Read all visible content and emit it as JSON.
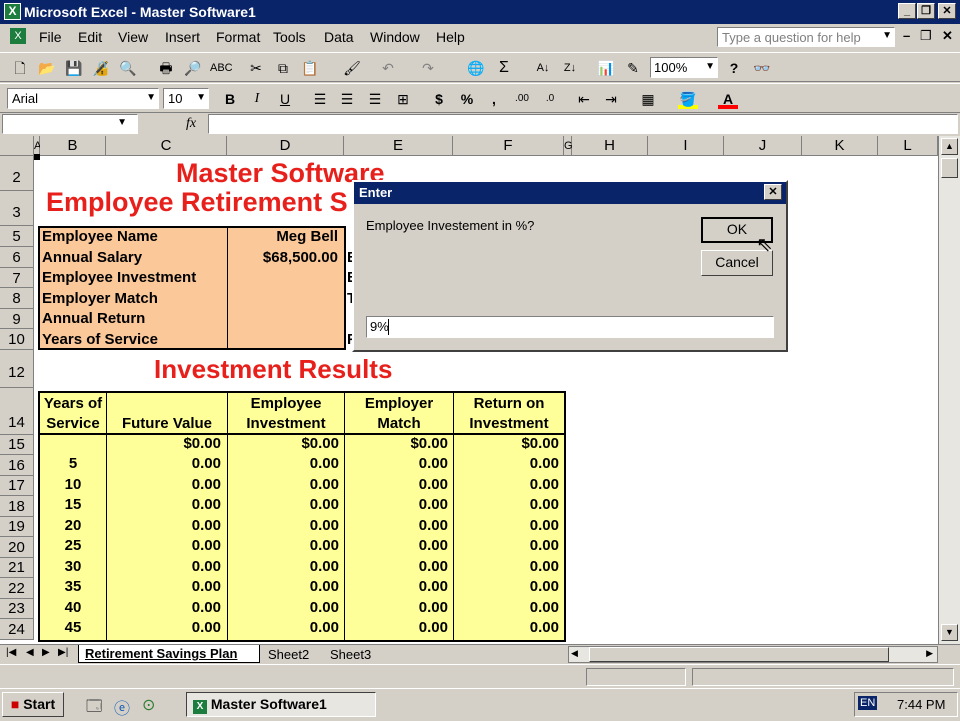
{
  "window": {
    "title": "Microsoft Excel - Master Software1"
  },
  "menu": {
    "items": [
      "File",
      "Edit",
      "View",
      "Insert",
      "Format",
      "Tools",
      "Data",
      "Window",
      "Help"
    ],
    "help_box_placeholder": "Type a question for help"
  },
  "toolbar": {
    "zoom": "100%",
    "font_name": "Arial",
    "font_size": "10"
  },
  "formula_bar": {
    "fx": "fx",
    "name_box": ""
  },
  "columns": [
    "A",
    "B",
    "C",
    "D",
    "E",
    "F",
    "G",
    "H",
    "I",
    "J",
    "K",
    "L"
  ],
  "rows": [
    "2",
    "3",
    "5",
    "6",
    "7",
    "8",
    "9",
    "10",
    "12",
    "14",
    "15",
    "16",
    "17",
    "18",
    "19",
    "20",
    "21",
    "22",
    "23",
    "24"
  ],
  "sheet": {
    "title1": "Master Software",
    "title2": "Employee Retirement S",
    "info_labels": [
      "Employee Name",
      "Annual Salary",
      "Employee Investment",
      "Employer Match",
      "Annual Return",
      "Years of Service"
    ],
    "info_values": [
      "Meg Bell",
      "$68,500.00",
      "",
      "",
      "",
      ""
    ],
    "e_col_fragments": [
      "",
      "E",
      "E",
      "T",
      "",
      "F"
    ],
    "results_title": "Investment Results",
    "headers": [
      [
        "Years of",
        "Service"
      ],
      [
        "",
        "Future Value"
      ],
      [
        "Employee",
        "Investment"
      ],
      [
        "Employer",
        "Match"
      ],
      [
        "Return on",
        "Investment"
      ]
    ],
    "results": [
      [
        "",
        "$0.00",
        "$0.00",
        "$0.00",
        "$0.00"
      ],
      [
        "5",
        "0.00",
        "0.00",
        "0.00",
        "0.00"
      ],
      [
        "10",
        "0.00",
        "0.00",
        "0.00",
        "0.00"
      ],
      [
        "15",
        "0.00",
        "0.00",
        "0.00",
        "0.00"
      ],
      [
        "20",
        "0.00",
        "0.00",
        "0.00",
        "0.00"
      ],
      [
        "25",
        "0.00",
        "0.00",
        "0.00",
        "0.00"
      ],
      [
        "30",
        "0.00",
        "0.00",
        "0.00",
        "0.00"
      ],
      [
        "35",
        "0.00",
        "0.00",
        "0.00",
        "0.00"
      ],
      [
        "40",
        "0.00",
        "0.00",
        "0.00",
        "0.00"
      ],
      [
        "45",
        "0.00",
        "0.00",
        "0.00",
        "0.00"
      ]
    ]
  },
  "dialog": {
    "title": "Enter",
    "prompt": "Employee Investement in %?",
    "ok": "OK",
    "cancel": "Cancel",
    "input_value": "9%"
  },
  "tabs": {
    "active": "Retirement Savings Plan",
    "others": [
      "Sheet2",
      "Sheet3"
    ]
  },
  "taskbar": {
    "start": "Start",
    "task": "Master Software1",
    "lang": "EN",
    "clock": "7:44 PM"
  },
  "colors": {
    "orange": "#fbc89a",
    "yellow": "#ffff99",
    "title_red": "#e8201c",
    "titlebar_blue": "#0a246a"
  }
}
